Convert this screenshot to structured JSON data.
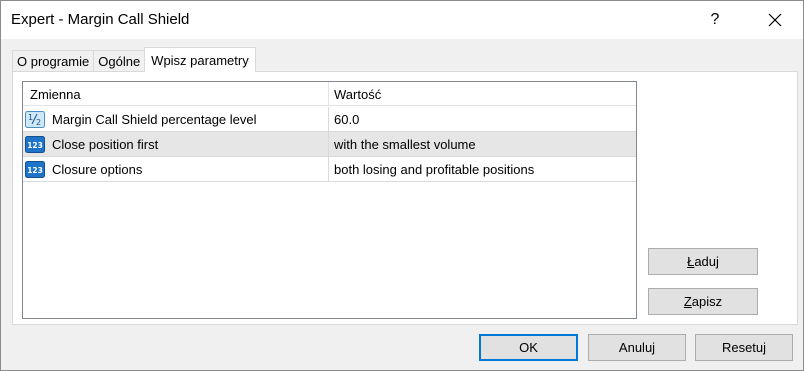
{
  "window": {
    "title": "Expert - Margin Call Shield",
    "help_label": "?"
  },
  "tabs": [
    {
      "label": "O programie",
      "active": false
    },
    {
      "label": "Ogólne",
      "active": false
    },
    {
      "label": "Wpisz parametry",
      "active": true
    }
  ],
  "grid": {
    "columns": {
      "variable": "Zmienna",
      "value": "Wartość"
    },
    "rows": [
      {
        "icon": "fraction-icon",
        "name": "Margin Call Shield percentage level",
        "value": "60.0",
        "selected": false
      },
      {
        "icon": "numeric-123-icon",
        "name": "Close position first",
        "value": "with the smallest volume",
        "selected": true
      },
      {
        "icon": "numeric-123-icon",
        "name": "Closure options",
        "value": "both losing and profitable positions",
        "selected": false
      }
    ]
  },
  "side_buttons": {
    "load_first": "Ł",
    "load_rest": "aduj",
    "save_first": "Z",
    "save_rest": "apisz"
  },
  "footer_buttons": {
    "ok": "OK",
    "cancel": "Anuluj",
    "reset": "Resetuj"
  },
  "colors": {
    "selected_row": "#e6e6e6",
    "default_button_border": "#0078d7",
    "icon_blue": "#1e74c8"
  }
}
